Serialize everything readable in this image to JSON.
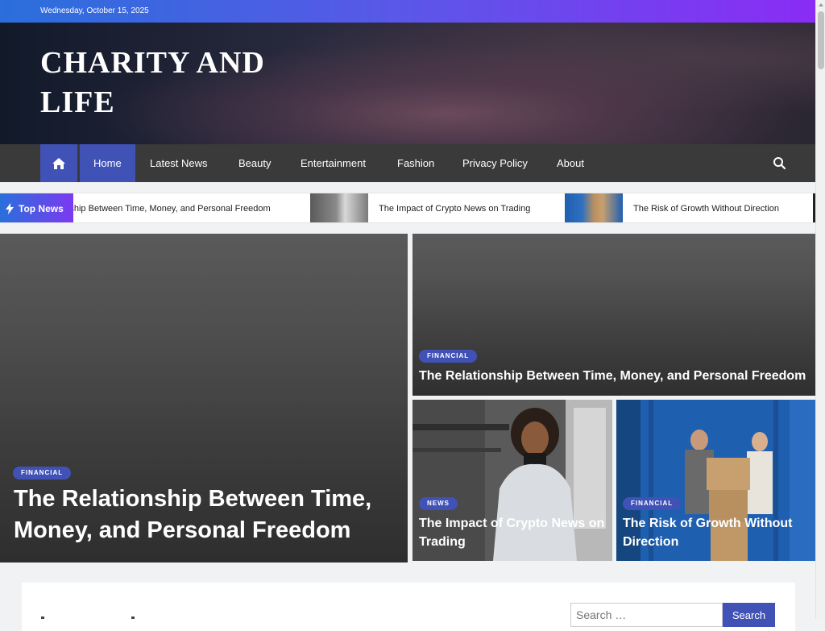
{
  "topbar": {
    "date": "Wednesday, October 15, 2025"
  },
  "site": {
    "title": "CHARITY AND LIFE"
  },
  "nav": {
    "items": [
      {
        "label": "Home",
        "active": true
      },
      {
        "label": "Latest News"
      },
      {
        "label": "Beauty"
      },
      {
        "label": "Entertainment"
      },
      {
        "label": "Fashion"
      },
      {
        "label": "Privacy Policy"
      },
      {
        "label": "About"
      }
    ]
  },
  "ticker": {
    "label": "Top News",
    "items": [
      {
        "text": "The Relationship Between Time, Money, and Personal Freedom"
      },
      {
        "text": "The Impact of Crypto News on Trading"
      },
      {
        "text": "The Risk of Growth Without Direction"
      }
    ]
  },
  "featured": {
    "main": {
      "category": "FINANCIAL",
      "title": "The Relationship Between Time, Money, and Personal Freedom"
    },
    "top_right": {
      "category": "FINANCIAL",
      "title": "The Relationship Between Time, Money, and Personal Freedom"
    },
    "bottom_left": {
      "category": "NEWS",
      "title": "The Impact of Crypto News on Trading"
    },
    "bottom_right": {
      "category": "FINANCIAL",
      "title": "The Risk of Growth Without Direction"
    }
  },
  "sidebar": {
    "search_placeholder": "Search …",
    "search_button": "Search"
  },
  "colors": {
    "accent": "#4152b7",
    "nav_bg": "#3a3a3a",
    "topbar_start": "#2a6fdb",
    "topbar_end": "#8a2cf5"
  }
}
